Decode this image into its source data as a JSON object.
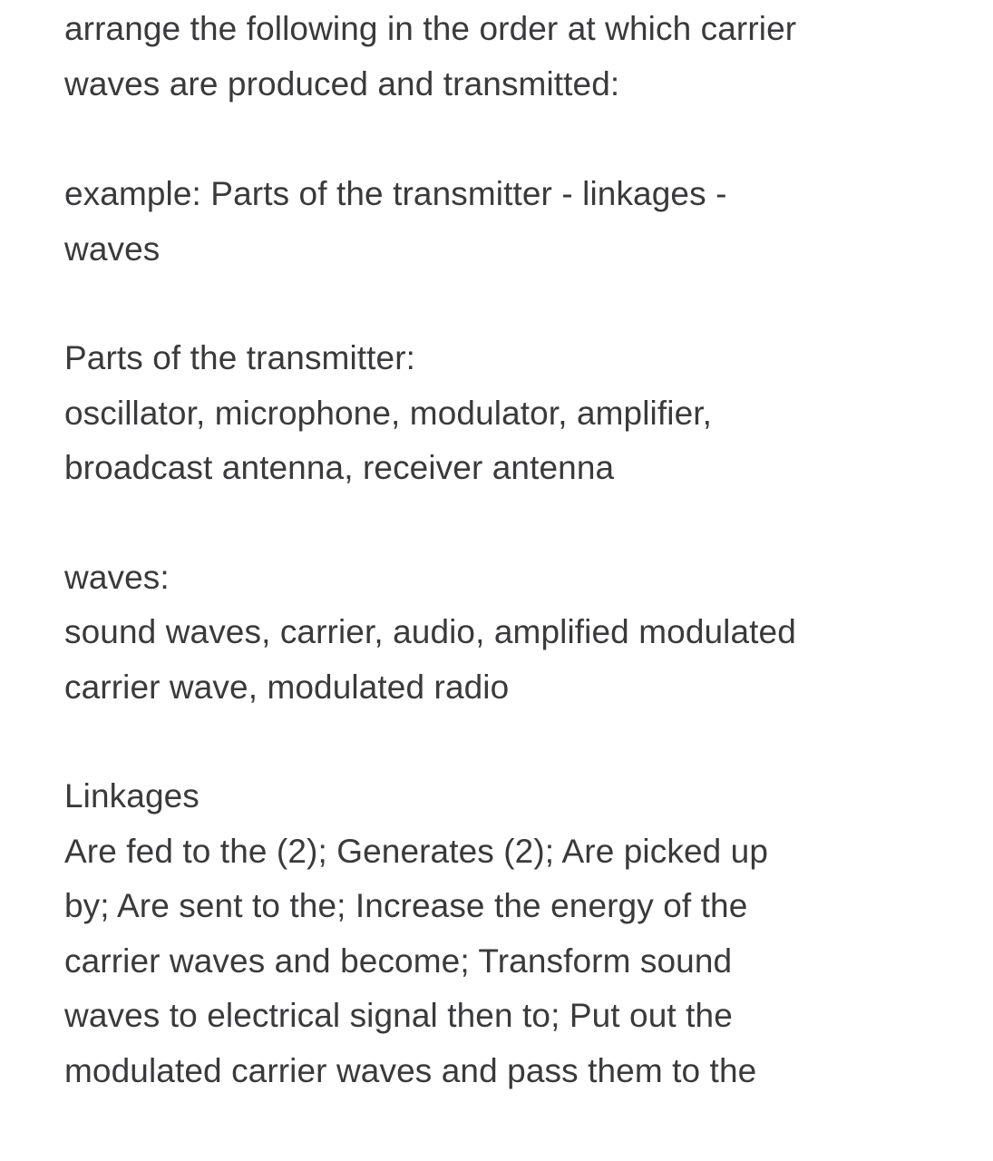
{
  "document": {
    "instruction": {
      "lines": [
        "arrange the following in the order at which carrier",
        "waves are produced and transmitted:"
      ]
    },
    "example": {
      "lines": [
        "example: Parts of the transmitter - linkages -",
        "waves"
      ]
    },
    "parts_of_transmitter": {
      "heading": "Parts of the transmitter:",
      "lines": [
        "oscillator, microphone, modulator, amplifier,",
        "broadcast antenna, receiver antenna"
      ]
    },
    "waves": {
      "heading": "waves:",
      "lines": [
        "sound waves, carrier, audio, amplified modulated",
        "carrier wave, modulated radio"
      ]
    },
    "linkages": {
      "heading": "Linkages",
      "lines": [
        "Are fed to the (2); Generates (2); Are picked up",
        "by; Are sent to the; Increase the energy of the",
        "carrier waves and become; Transform sound",
        "waves to electrical signal then to; Put out the",
        "modulated carrier waves and pass them to the"
      ]
    }
  },
  "colors": {
    "text": "#3a3a3c",
    "background": "#ffffff"
  }
}
